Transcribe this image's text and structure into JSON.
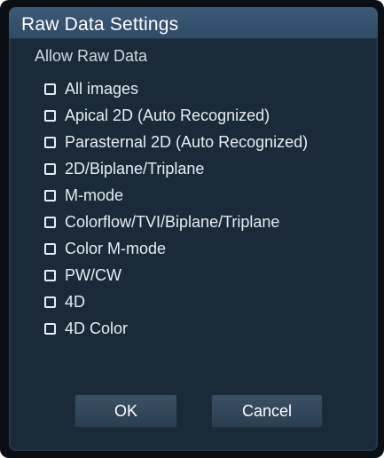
{
  "dialog": {
    "title": "Raw Data Settings",
    "section_label": "Allow Raw Data",
    "options": [
      {
        "label": "All images",
        "checked": false
      },
      {
        "label": "Apical 2D (Auto Recognized)",
        "checked": false
      },
      {
        "label": "Parasternal 2D (Auto Recognized)",
        "checked": false
      },
      {
        "label": "2D/Biplane/Triplane",
        "checked": false
      },
      {
        "label": "M-mode",
        "checked": false
      },
      {
        "label": "Colorflow/TVI/Biplane/Triplane",
        "checked": false
      },
      {
        "label": "Color M-mode",
        "checked": false
      },
      {
        "label": "PW/CW",
        "checked": false
      },
      {
        "label": "4D",
        "checked": false
      },
      {
        "label": "4D Color",
        "checked": false
      }
    ],
    "buttons": {
      "ok_label": "OK",
      "cancel_label": "Cancel"
    }
  }
}
